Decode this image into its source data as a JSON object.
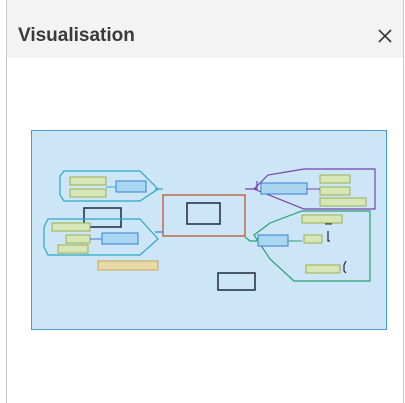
{
  "panel": {
    "title": "Visualisation",
    "close_icon": "close-icon"
  },
  "colors": {
    "title_bar": "#f3f3f3",
    "viewport_fill": "#cde6f7",
    "viewport_border": "#4a9ae0",
    "central_node": "#c0694a",
    "branch_teal": "#2aa7c4",
    "branch_blue": "#3a7fd0",
    "branch_purple": "#7a3fb0",
    "branch_green": "#2aa070",
    "leaf_olive": "#9ab04a",
    "leaf_tan": "#c9a64a",
    "floating_node": "#2a2a2a"
  }
}
